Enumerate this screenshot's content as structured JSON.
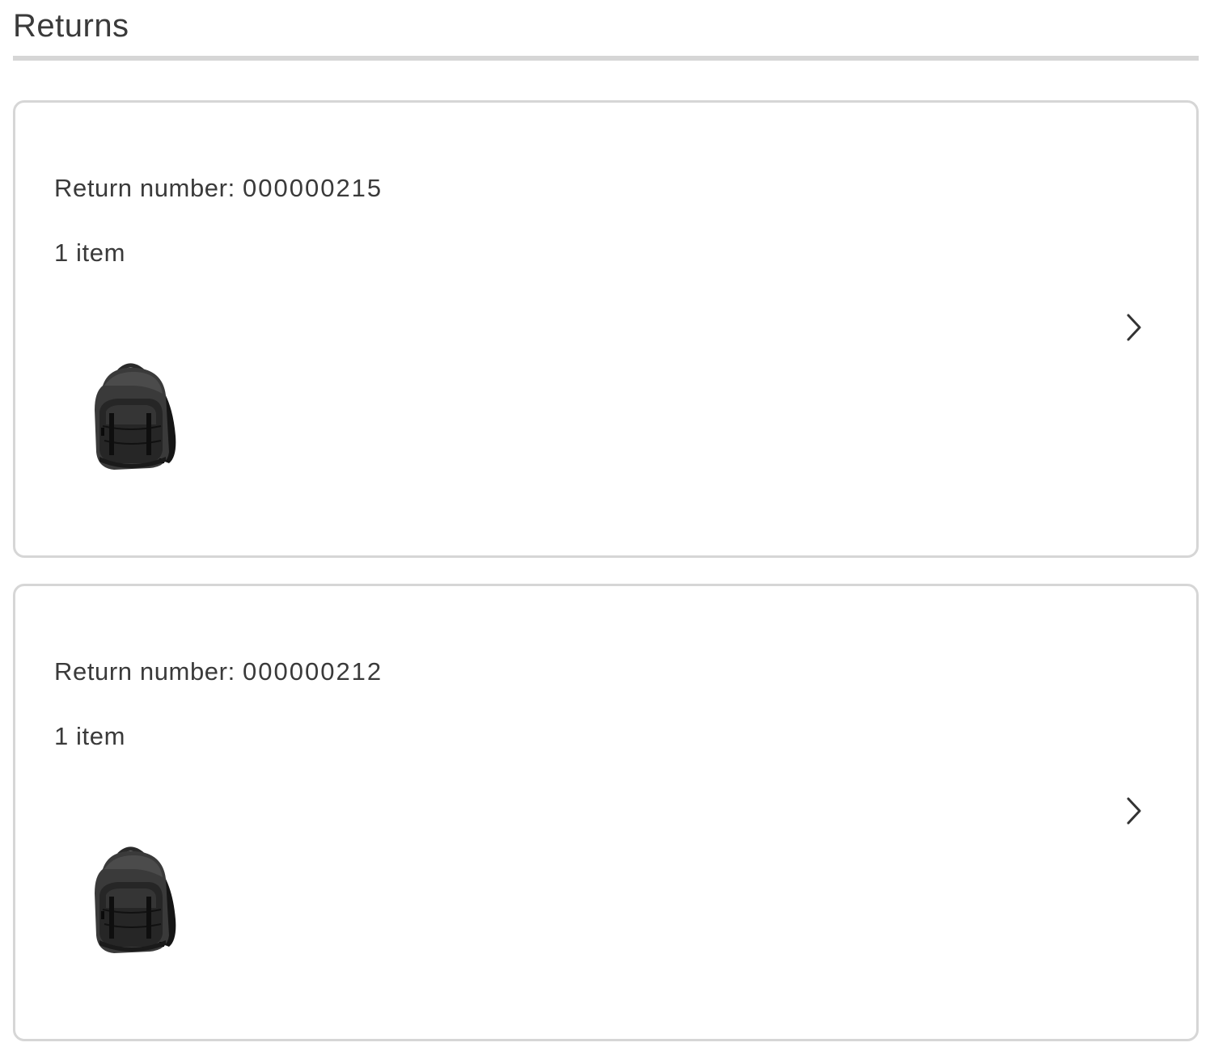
{
  "page": {
    "title": "Returns"
  },
  "returns": [
    {
      "label": "Return number:",
      "number": "000000215",
      "item_count": "1 item",
      "icon": "chevron-right-icon",
      "thumbnail": "backpack-image"
    },
    {
      "label": "Return number:",
      "number": "000000212",
      "item_count": "1 item",
      "icon": "chevron-right-icon",
      "thumbnail": "backpack-image"
    }
  ],
  "colors": {
    "text": "#3a3a3a",
    "border": "#d6d6d6",
    "background": "#ffffff"
  }
}
